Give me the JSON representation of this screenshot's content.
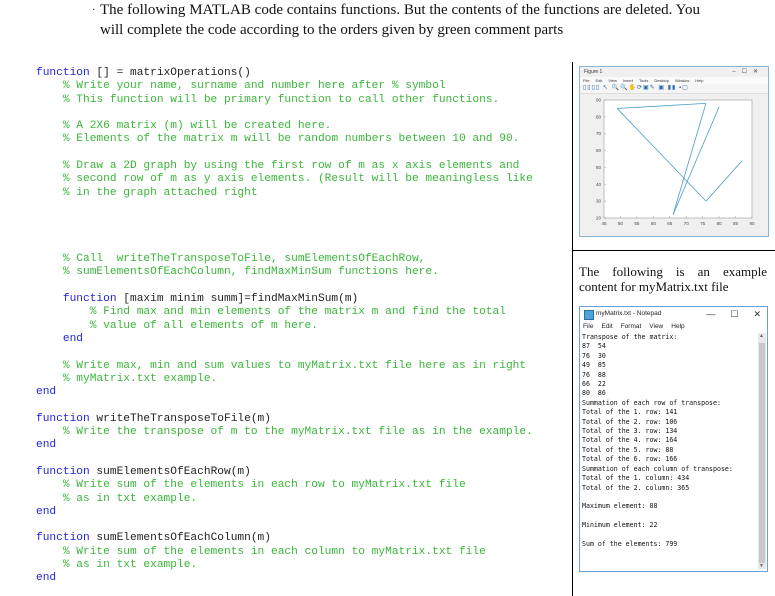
{
  "intro": {
    "bullet": "·",
    "text": "The following MATLAB code contains functions. But the contents of the functions are deleted. You will complete the code according to the orders given by green comment parts"
  },
  "code_lines": [
    {
      "type": "kw",
      "text": "function [] = matrixOperations()"
    },
    {
      "type": "cm",
      "text": "    % Write your name, surname and number here after % symbol"
    },
    {
      "type": "cm",
      "text": "    % This function will be primary function to call other functions."
    },
    {
      "type": "blank",
      "text": ""
    },
    {
      "type": "cm",
      "text": "    % A 2X6 matrix (m) will be created here."
    },
    {
      "type": "cm",
      "text": "    % Elements of the matrix m will be random numbers between 10 and 90."
    },
    {
      "type": "blank",
      "text": ""
    },
    {
      "type": "cm",
      "text": "    % Draw a 2D graph by using the first row of m as x axis elements and"
    },
    {
      "type": "cm",
      "text": "    % second row of m as y axis elements. (Result will be meaningless like"
    },
    {
      "type": "cm",
      "text": "    % in the graph attached right"
    },
    {
      "type": "blank",
      "text": ""
    },
    {
      "type": "blank",
      "text": ""
    },
    {
      "type": "blank",
      "text": ""
    },
    {
      "type": "blank",
      "text": ""
    },
    {
      "type": "cm",
      "text": "    % Call  writeTheTransposeToFile, sumElementsOfEachRow,"
    },
    {
      "type": "cm",
      "text": "    % sumElementsOfEachColumn, findMaxMinSum functions here."
    },
    {
      "type": "blank",
      "text": ""
    },
    {
      "type": "kw",
      "text": "    function [maxim minim summ]=findMaxMinSum(m)"
    },
    {
      "type": "cm",
      "text": "        % Find max and min elements of the matrix m and find the total"
    },
    {
      "type": "cm",
      "text": "        % value of all elements of m here."
    },
    {
      "type": "end",
      "text": "    end"
    },
    {
      "type": "blank",
      "text": ""
    },
    {
      "type": "cm",
      "text": "    % Write max, min and sum values to myMatrix.txt file here as in right"
    },
    {
      "type": "cm",
      "text": "    % myMatrix.txt example."
    },
    {
      "type": "end",
      "text": "end"
    },
    {
      "type": "blank",
      "text": ""
    },
    {
      "type": "kw",
      "text": "function writeTheTransposeToFile(m)"
    },
    {
      "type": "cm",
      "text": "    % Write the transpose of m to the myMatrix.txt file as in the example."
    },
    {
      "type": "end",
      "text": "end"
    },
    {
      "type": "blank",
      "text": ""
    },
    {
      "type": "kw",
      "text": "function sumElementsOfEachRow(m)"
    },
    {
      "type": "cm",
      "text": "    % Write sum of the elements in each row to myMatrix.txt file"
    },
    {
      "type": "cm",
      "text": "    % as in txt example."
    },
    {
      "type": "end",
      "text": "end"
    },
    {
      "type": "blank",
      "text": ""
    },
    {
      "type": "kw",
      "text": "function sumElementsOfEachColumn(m)"
    },
    {
      "type": "cm",
      "text": "    % Write sum of the elements in each column to myMatrix.txt file"
    },
    {
      "type": "cm",
      "text": "    % as in txt example."
    },
    {
      "type": "end",
      "text": "end"
    }
  ],
  "figure_window": {
    "title": "Figure 1",
    "controls": [
      "–",
      "☐",
      "✕"
    ],
    "menu": [
      "File",
      "Edit",
      "View",
      "Insert",
      "Tools",
      "Desktop",
      "Window",
      "Help"
    ],
    "toolbar": "▯▯▯▯ ↖ 🔍🔍✋⟳▣✎ ▣ ▮▮ ▪▢"
  },
  "chart_data": {
    "type": "line",
    "title": "",
    "xlabel": "",
    "ylabel": "",
    "x": [
      87,
      76,
      49,
      76,
      66,
      80
    ],
    "y": [
      54,
      30,
      85,
      88,
      22,
      86
    ],
    "xlim": [
      45,
      90
    ],
    "ylim": [
      20,
      90
    ],
    "xticks": [
      45,
      50,
      55,
      60,
      65,
      70,
      75,
      80,
      85,
      90
    ],
    "yticks": [
      20,
      30,
      40,
      50,
      60,
      70,
      80,
      90
    ],
    "line_color": "#4d9cc9",
    "grid": false
  },
  "caption": "The following is an example content for myMatrix.txt file",
  "notepad": {
    "title": "myMatrix.txt - Notepad",
    "controls": [
      "—",
      "☐",
      "✕"
    ],
    "menu": [
      "File",
      "Edit",
      "Format",
      "View",
      "Help"
    ],
    "content": "Transpose of the matrix:\n87  54\n76  30\n49  85\n76  88\n66  22\n80  86\nSummation of each row of transpose:\nTotal of the 1. row: 141\nTotal of the 2. row: 106\nTotal of the 3. row: 134\nTotal of the 4. row: 164\nTotal of the 5. row: 88\nTotal of the 6. row: 166\nSummation of each column of transpose:\nTotal of the 1. column: 434\nTotal of the 2. column: 365\n\nMaximum element: 88\n\nMinimum element: 22\n\nSum of the elements: 799"
  }
}
